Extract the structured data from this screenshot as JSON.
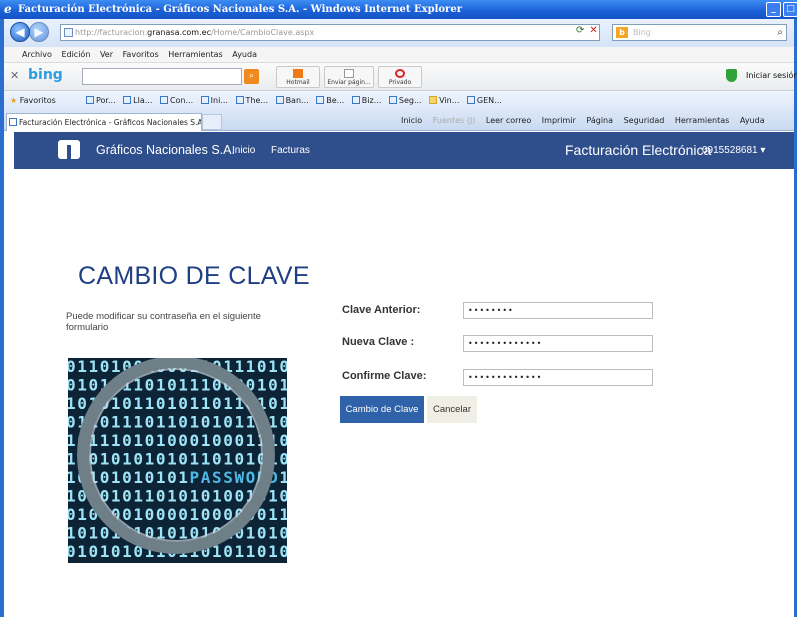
{
  "browser": {
    "window_title": "Facturación Electrónica - Gráficos Nacionales S.A. - Windows Internet Explorer",
    "address": {
      "prefix": "http://facturacion.",
      "host": "granasa.com.ec",
      "path": "/Home/CambioClave.aspx"
    },
    "search_engine_label": "Bing",
    "menu": [
      "Archivo",
      "Edición",
      "Ver",
      "Favoritos",
      "Herramientas",
      "Ayuda"
    ],
    "bing_toolbar": {
      "logo": "bing",
      "buttons": [
        {
          "label": "Hotmail",
          "icon": "hotmail-icon"
        },
        {
          "label": "Enviar págin...",
          "icon": "send-page-icon"
        },
        {
          "label": "Privado",
          "icon": "private-icon"
        }
      ],
      "signin_label": "Iniciar sesión"
    },
    "favorites": {
      "label": "Favoritos",
      "items": [
        "Por...",
        "Lla...",
        "Con...",
        "Ini...",
        "The...",
        "Ban...",
        "Be...",
        "Biz...",
        "Seg...",
        "Vin...",
        "GEN..."
      ]
    },
    "tab_title": "Facturación Electrónica - Gráficos Nacionales S.A.",
    "command_bar": [
      "Inicio",
      "Fuentes (J)",
      "Leer correo",
      "Imprimir",
      "Página",
      "Seguridad",
      "Herramientas",
      "Ayuda"
    ]
  },
  "site": {
    "brand": "Gráficos Nacionales S.A.",
    "nav": [
      "Inicio",
      "Facturas"
    ],
    "section_title": "Facturación Electrónica",
    "user": "0915528681"
  },
  "page": {
    "title": "CAMBIO DE CLAVE",
    "intro": "Puede modificar su contraseña en el siguiente formulario",
    "fields": [
      {
        "label": "Clave Anterior:",
        "value": "••••••••"
      },
      {
        "label": "Nueva Clave :",
        "value": "•••••••••••••"
      },
      {
        "label": "Confirme Clave:",
        "value": "•••••••••••••"
      }
    ],
    "submit_label": "Cambio de Clave",
    "cancel_label": "Cancelar",
    "image_text": "PASSWORD",
    "image_binary_rows": [
      "01101001000110111010",
      "01010110101110000101",
      "10101011010110110101",
      "01101110110101011010",
      "10111010100010001110",
      "11010101010110101010",
      "10101010101PASSWORD1",
      "10101011010101001010",
      "01010010000100000011",
      "10101010101010101010",
      "01010101101101011010"
    ]
  }
}
